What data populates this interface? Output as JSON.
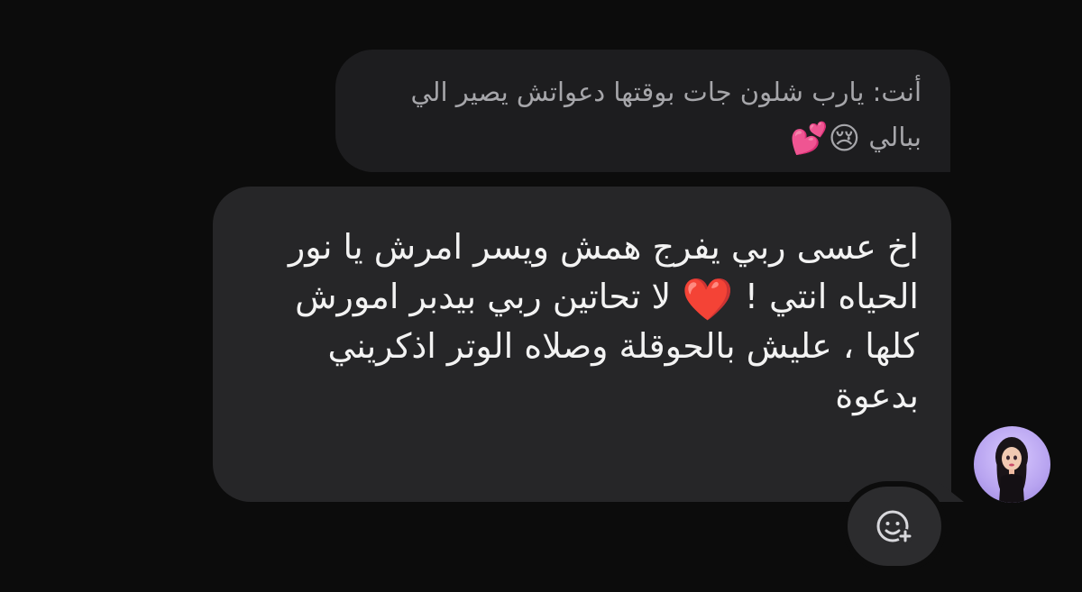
{
  "reply": {
    "text": "أنت: يارب شلون جات بوقتها دعواتش يصير الي ببالي",
    "emoji_cry": "😢",
    "emoji_hearts": "💕"
  },
  "message": {
    "text_before_heart": "اخ عسى ربي يفرج همش ويسر امرش يا نور الحياه انتي !",
    "heart": "❤️",
    "text_after_heart": "لا تحاتين ربي بيدبر امورش كلها ، عليش بالحوقلة وصلاه الوتر اذكريني بدعوة"
  },
  "avatar": {
    "icon": "avatar-doll-icon"
  },
  "reaction": {
    "icon": "add-reaction-icon"
  },
  "colors": {
    "background": "#0c0c0c",
    "reply_bubble": "#1d1d1f",
    "message_bubble": "#262628",
    "reply_text": "#a6a6aa",
    "message_text": "#f3f3f3"
  }
}
